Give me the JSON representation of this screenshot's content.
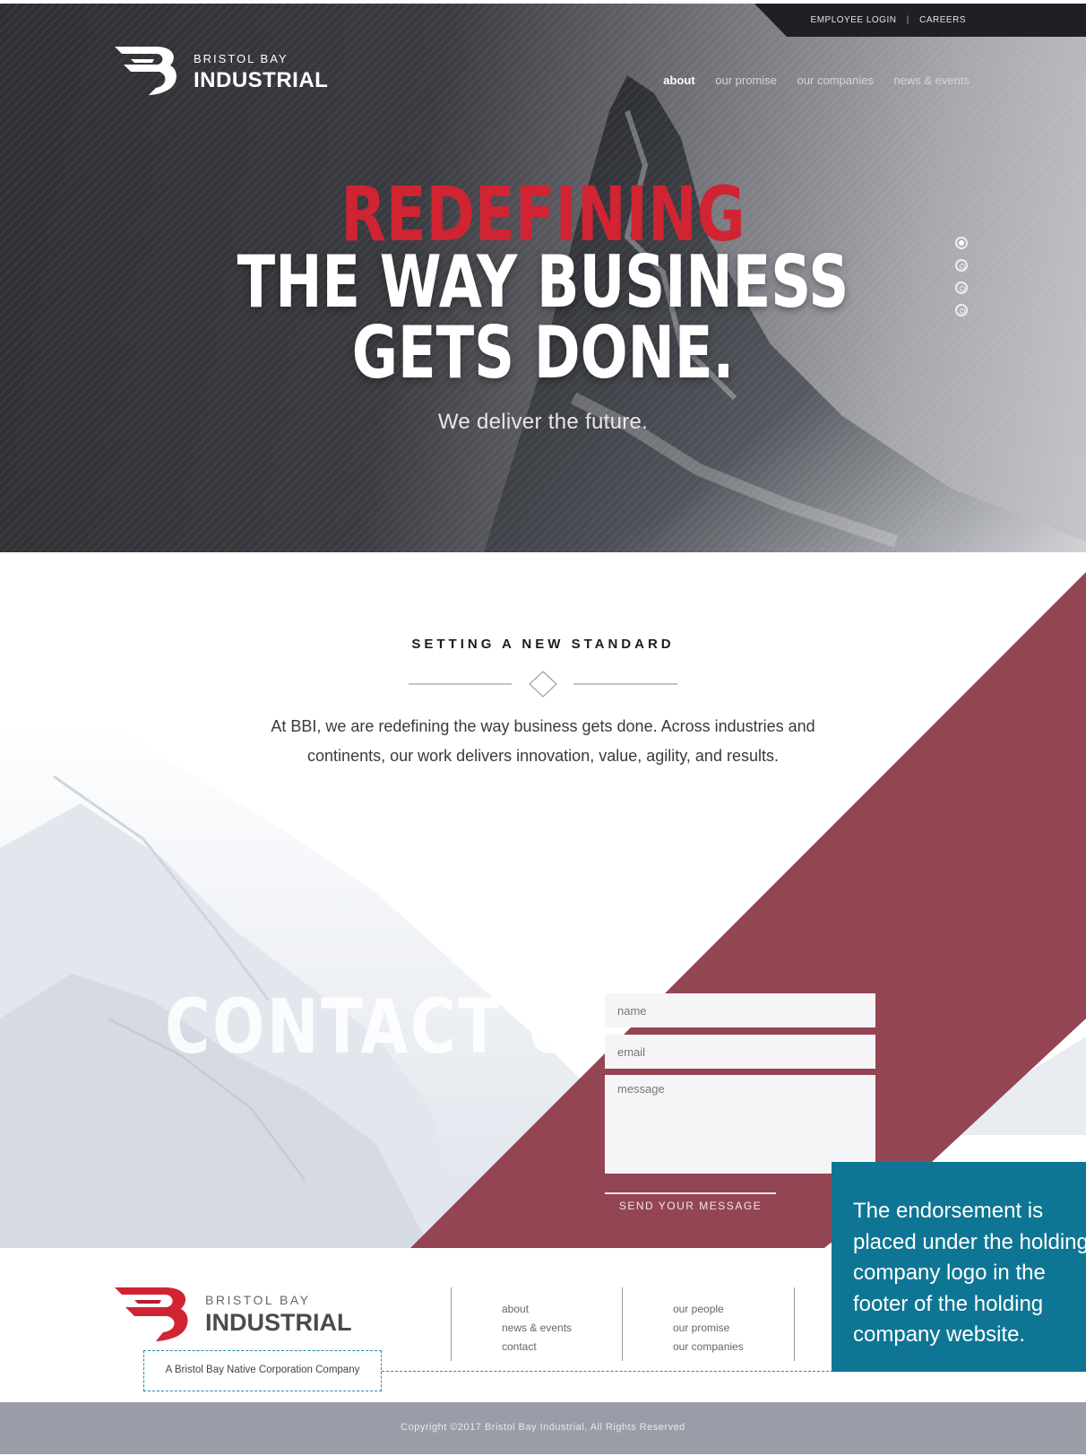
{
  "topbar": {
    "employee_login": "EMPLOYEE LOGIN",
    "separator": "|",
    "careers": "CAREERS"
  },
  "brand": {
    "line1": "BRISTOL BAY",
    "line2": "INDUSTRIAL",
    "accent_color": "#d02433"
  },
  "nav": {
    "items": [
      "about",
      "our promise",
      "our companies",
      "news & events"
    ],
    "active": "about"
  },
  "hero": {
    "line1": "REDEFINING",
    "line2": "THE WAY BUSINESS",
    "line3": "GETS DONE.",
    "tagline": "We deliver the future.",
    "slide_count": 4,
    "active_slide": 1
  },
  "standard": {
    "title": "SETTING A NEW STANDARD",
    "body": "At BBI, we are redefining the way business gets done. Across industries and continents, our work delivers innovation, value, agility, and results."
  },
  "contact": {
    "title": "CONTACT US",
    "name_placeholder": "name",
    "email_placeholder": "email",
    "message_placeholder": "message",
    "send_label": "SEND YOUR MESSAGE"
  },
  "footer": {
    "brand_line1": "BRISTOL BAY",
    "brand_line2": "INDUSTRIAL",
    "endorsement": "A Bristol Bay Native Corporation Company",
    "col1": [
      "about",
      "news & events",
      "contact"
    ],
    "col2": [
      "our people",
      "our promise",
      "our companies"
    ],
    "copyright": "Copyright ©2017 Bristol Bay Industrial, All Rights Reserved"
  },
  "callout": {
    "lines": [
      "The endorsement is",
      "placed under the holding",
      "company logo in the",
      "footer of the holding",
      "company website."
    ],
    "color": "#0e7694"
  }
}
